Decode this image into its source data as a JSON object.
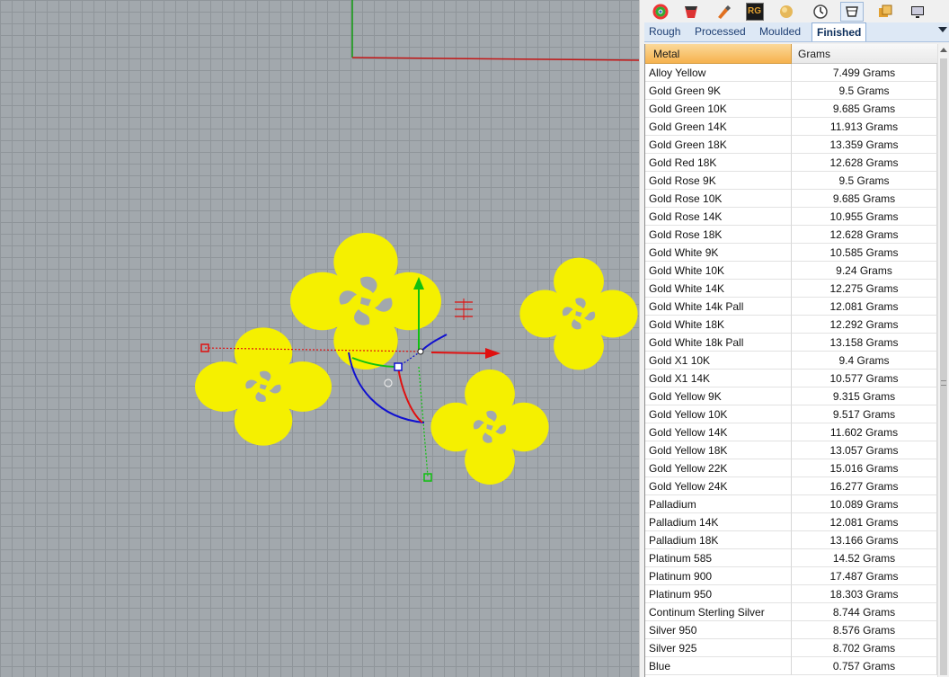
{
  "toolbar": {
    "icons": [
      "color-wheel-icon",
      "material-icon",
      "brush-icon",
      "rg-icon",
      "sphere-icon",
      "clock-icon",
      "gem-setting-icon",
      "layers-icon",
      "display-icon"
    ],
    "rg_label": "RG"
  },
  "tabs": [
    {
      "label": "Rough",
      "active": false
    },
    {
      "label": "Processed",
      "active": false
    },
    {
      "label": "Moulded",
      "active": false
    },
    {
      "label": "Finished",
      "active": true
    }
  ],
  "table": {
    "columns": [
      "Metal",
      "Grams"
    ],
    "rows": [
      [
        "Alloy Yellow",
        "7.499 Grams"
      ],
      [
        "Gold Green 9K",
        "9.5 Grams"
      ],
      [
        "Gold Green 10K",
        "9.685 Grams"
      ],
      [
        "Gold Green 14K",
        "11.913 Grams"
      ],
      [
        "Gold Green 18K",
        "13.359 Grams"
      ],
      [
        "Gold Red 18K",
        "12.628 Grams"
      ],
      [
        "Gold Rose 9K",
        "9.5 Grams"
      ],
      [
        "Gold Rose 10K",
        "9.685 Grams"
      ],
      [
        "Gold Rose 14K",
        "10.955 Grams"
      ],
      [
        "Gold Rose 18K",
        "12.628 Grams"
      ],
      [
        "Gold White 9K",
        "10.585 Grams"
      ],
      [
        "Gold White 10K",
        "9.24 Grams"
      ],
      [
        "Gold White 14K",
        "12.275 Grams"
      ],
      [
        "Gold White 14k Pall",
        "12.081 Grams"
      ],
      [
        "Gold White 18K",
        "12.292 Grams"
      ],
      [
        "Gold White 18k Pall",
        "13.158 Grams"
      ],
      [
        "Gold X1 10K",
        "9.4 Grams"
      ],
      [
        "Gold X1 14K",
        "10.577 Grams"
      ],
      [
        "Gold Yellow 9K",
        "9.315 Grams"
      ],
      [
        "Gold Yellow 10K",
        "9.517 Grams"
      ],
      [
        "Gold Yellow 14K",
        "11.602 Grams"
      ],
      [
        "Gold Yellow 18K",
        "13.057 Grams"
      ],
      [
        "Gold Yellow 22K",
        "15.016 Grams"
      ],
      [
        "Gold Yellow 24K",
        "16.277 Grams"
      ],
      [
        "Palladium",
        "10.089 Grams"
      ],
      [
        "Palladium 14K",
        "12.081 Grams"
      ],
      [
        "Palladium 18K",
        "13.166 Grams"
      ],
      [
        "Platinum 585",
        "14.52 Grams"
      ],
      [
        "Platinum 900",
        "17.487 Grams"
      ],
      [
        "Platinum 950",
        "18.303 Grams"
      ],
      [
        "Continum Sterling Silver",
        "8.744 Grams"
      ],
      [
        "Silver 950",
        "8.576 Grams"
      ],
      [
        "Silver 925",
        "8.702 Grams"
      ],
      [
        "Blue",
        "0.757 Grams"
      ]
    ]
  },
  "colors": {
    "object_fill": "#f5f000",
    "axis_x": "#e01010",
    "axis_y": "#10c010",
    "axis_z": "#1010d0",
    "header_accent": "#f6b24e",
    "active_tab": "#ffffff"
  }
}
